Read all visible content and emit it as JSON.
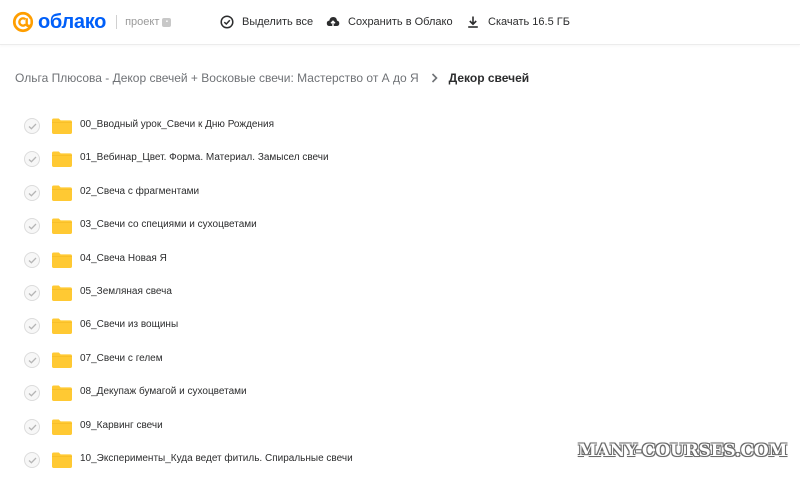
{
  "header": {
    "logo_text": "облако",
    "project_label": "проект",
    "select_all_label": "Выделить все",
    "save_label": "Сохранить в Облако",
    "download_label": "Скачать 16.5 ГБ",
    "brand_color": "#005ff9",
    "icons": {
      "logo": "at-sign-icon",
      "select_all": "check-circle-icon",
      "save": "cloud-upload-icon",
      "download": "download-icon"
    }
  },
  "breadcrumb": {
    "parent": "Ольга Плюсова - Декор свечей + Восковые свечи: Мастерство от А до Я",
    "current": "Декор свечей"
  },
  "files": [
    {
      "name": "00_Вводный урок_Свечи к Дню Рождения"
    },
    {
      "name": "01_Вебинар_Цвет. Форма. Материал. Замысел свечи"
    },
    {
      "name": "02_Свеча с фрагментами"
    },
    {
      "name": "03_Свечи со специями и сухоцветами"
    },
    {
      "name": "04_Свеча Новая Я"
    },
    {
      "name": "05_Земляная свеча"
    },
    {
      "name": "06_Свечи из вощины"
    },
    {
      "name": "07_Свечи с гелем"
    },
    {
      "name": "08_Декупаж бумагой и сухоцветами"
    },
    {
      "name": "09_Карвинг свечи"
    },
    {
      "name": "10_Эксперименты_Куда ведет фитиль. Спиральные свечи"
    }
  ],
  "folder_color": "#ffc933",
  "watermark": "MANY-COURSES.COM"
}
